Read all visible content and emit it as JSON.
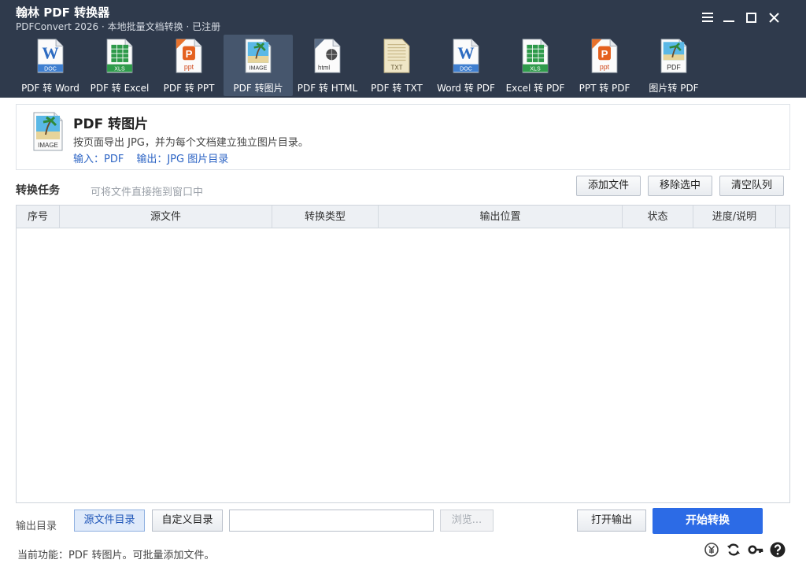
{
  "window": {
    "title": "翰林 PDF 转换器",
    "subtitle": "PDFConvert 2026 · 本地批量文档转换 · 已注册"
  },
  "toolbar": {
    "items": [
      {
        "label": "PDF 转 Word",
        "icon": "word-doc-icon",
        "tag": "W",
        "sub": "DOC"
      },
      {
        "label": "PDF 转 Excel",
        "icon": "excel-xls-icon",
        "tag": "",
        "sub": "XLS"
      },
      {
        "label": "PDF 转 PPT",
        "icon": "ppt-icon",
        "tag": "P",
        "sub": "ppt"
      },
      {
        "label": "PDF 转图片",
        "icon": "image-file-icon",
        "tag": "",
        "sub": "IMAGE"
      },
      {
        "label": "PDF 转 HTML",
        "icon": "html-file-icon",
        "tag": "",
        "sub": "html"
      },
      {
        "label": "PDF 转 TXT",
        "icon": "txt-file-icon",
        "tag": "",
        "sub": "TXT"
      },
      {
        "label": "Word 转 PDF",
        "icon": "word-doc-icon",
        "tag": "W",
        "sub": "DOC"
      },
      {
        "label": "Excel 转 PDF",
        "icon": "excel-xls-icon",
        "tag": "",
        "sub": "XLS"
      },
      {
        "label": "PPT 转 PDF",
        "icon": "ppt-icon",
        "tag": "P",
        "sub": "ppt"
      },
      {
        "label": "图片转 PDF",
        "icon": "pdf-image-icon",
        "tag": "",
        "sub": "PDF"
      }
    ],
    "active_index": 3
  },
  "info": {
    "title": "PDF 转图片",
    "description": "按页面导出 JPG，并为每个文档建立独立图片目录。",
    "input": "输入：PDF",
    "output": "输出：JPG 图片目录",
    "icon_sub": "IMAGE"
  },
  "tasks": {
    "title": "转换任务",
    "hint": "可将文件直接拖到窗口中",
    "add_label": "添加文件",
    "remove_label": "移除选中",
    "clear_label": "清空队列"
  },
  "table": {
    "columns": [
      "序号",
      "源文件",
      "转换类型",
      "输出位置",
      "状态",
      "进度/说明"
    ],
    "rows": []
  },
  "output": {
    "label": "输出目录",
    "source_dir_label": "源文件目录",
    "custom_dir_label": "自定义目录",
    "path_value": "",
    "browse_label": "浏览...",
    "open_label": "打开输出",
    "start_label": "开始转换"
  },
  "status": {
    "text": "当前功能：PDF 转图片。可批量添加文件。"
  },
  "colors": {
    "header_bg": "#2f3a4c",
    "toolbar_active": "#46566d",
    "accent": "#2c6be6",
    "link": "#2b63c4"
  }
}
